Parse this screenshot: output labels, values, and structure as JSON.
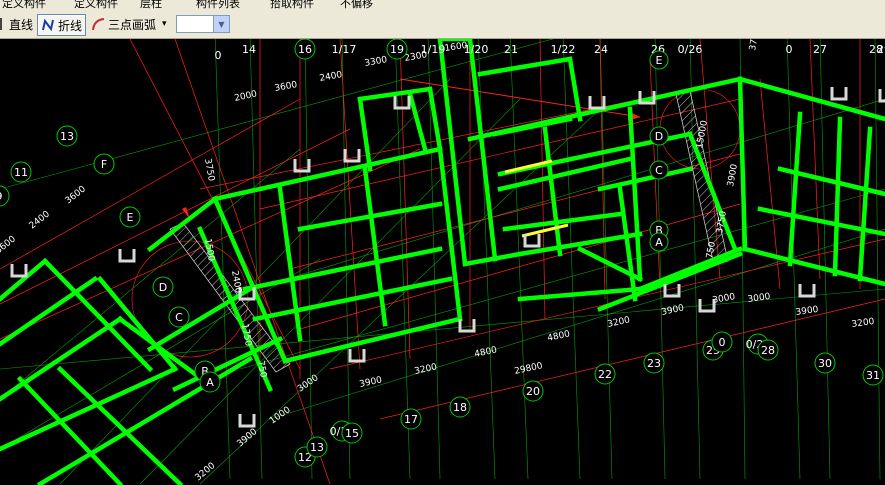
{
  "toolbar_top": {
    "items": [
      "定义构件",
      "层柱",
      "构件列表",
      "拾取构件",
      "不偏移"
    ]
  },
  "toolbar": {
    "line_label": "直线",
    "polyline_label": "折线",
    "arc_label": "三点画弧",
    "combo_value": ""
  },
  "drawing": {
    "colors": {
      "axis": "#00c800",
      "beam": "#00ff00",
      "red": "#ff2020",
      "label": "#ffffff",
      "hatch": "#c8c8c8",
      "yellow": "#ffff33"
    },
    "axis_labels_top": [
      "0",
      "14",
      "16",
      "1/17",
      "19",
      "1/19",
      "1/20",
      "21",
      "1/22",
      "24",
      "26",
      "0/26",
      "0",
      "27",
      "28",
      "29"
    ],
    "axis_labels_bottom": [
      "12",
      "13",
      "0/13",
      "15",
      "17",
      "18",
      "20",
      "22",
      "23",
      "25",
      "0",
      "0/26",
      "28",
      "30",
      "31"
    ],
    "axis_labels_left": [
      "13",
      "11",
      "9",
      "F",
      "E",
      "D",
      "C",
      "B",
      "A"
    ],
    "axis_labels_right": [
      "E",
      "D",
      "C",
      "B",
      "A"
    ],
    "dims_top": [
      "2000",
      "3600",
      "2400",
      "3300",
      "2300",
      "1600",
      "3750"
    ],
    "dims_left": [
      "3600",
      "2400",
      "3600",
      "3750",
      "1500",
      "2400",
      "1750",
      "750"
    ],
    "dims_bottom": [
      "3900",
      "3200",
      "4800",
      "4800",
      "3200",
      "3900",
      "3000",
      "3000",
      "3900",
      "3200",
      "29800",
      "1000",
      "3000",
      "3900",
      "3200"
    ],
    "dims_right": [
      "15000",
      "3900",
      "3750",
      "750"
    ]
  }
}
